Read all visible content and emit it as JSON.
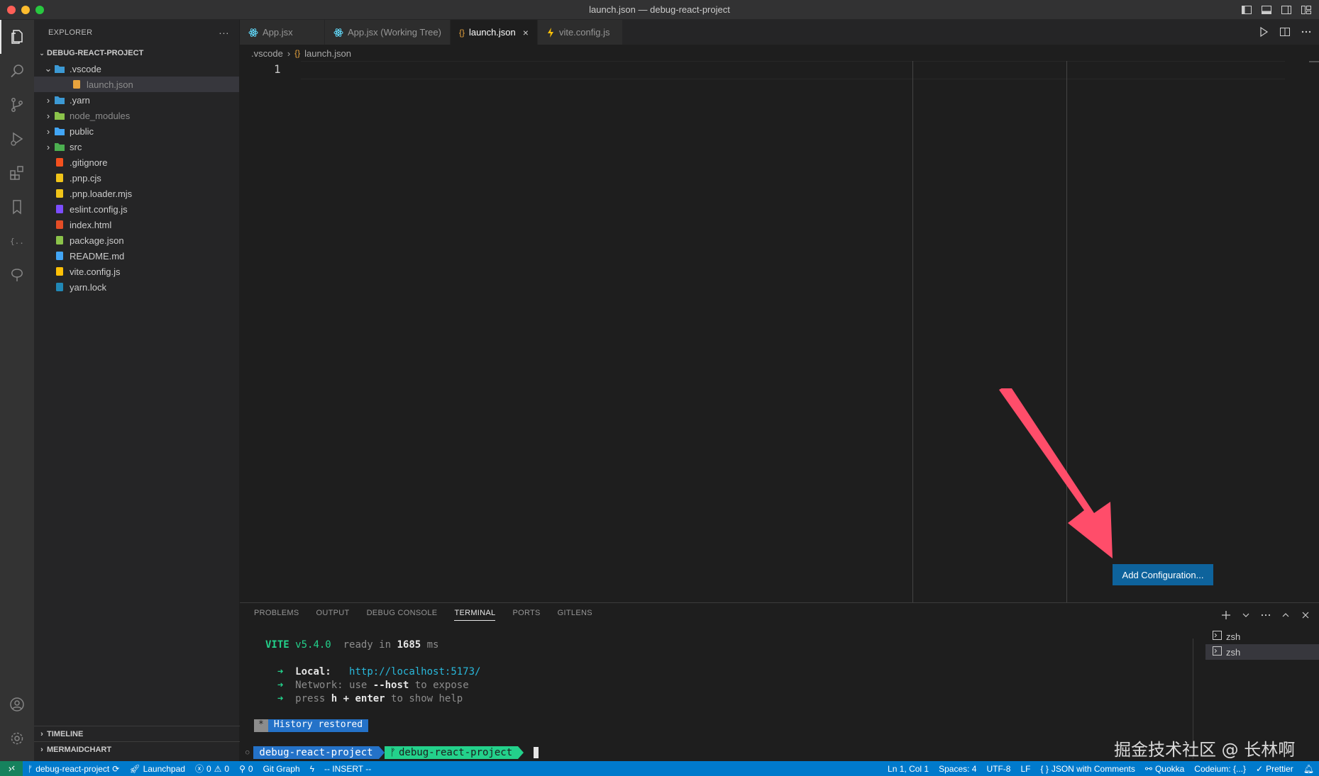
{
  "window": {
    "title": "launch.json — debug-react-project",
    "traffic_colors": [
      "#ff5f57",
      "#febc2e",
      "#28c840"
    ]
  },
  "activity": {
    "icons": [
      "files-icon",
      "search-icon",
      "source-control-icon",
      "run-debug-icon",
      "extensions-icon",
      "bookmark-icon",
      "json-icon",
      "tree-icon",
      "account-icon",
      "settings-gear-icon"
    ]
  },
  "explorer": {
    "title": "EXPLORER",
    "more": "···",
    "project": "DEBUG-REACT-PROJECT",
    "items": [
      {
        "label": ".vscode",
        "depth": 1,
        "expanded": true,
        "folder": true,
        "icon": "vscode-folder-icon",
        "color": "#3c99d4"
      },
      {
        "label": "launch.json",
        "depth": 2,
        "selected": true,
        "icon": "json-braces-icon",
        "color": "#e8a33d",
        "muted": true
      },
      {
        "label": ".yarn",
        "depth": 1,
        "folder": true,
        "icon": "yarn-folder-icon",
        "color": "#3c99d4"
      },
      {
        "label": "node_modules",
        "depth": 1,
        "folder": true,
        "icon": "node-folder-icon",
        "color": "#8bc34a",
        "muted": true
      },
      {
        "label": "public",
        "depth": 1,
        "folder": true,
        "icon": "public-folder-icon",
        "color": "#42a5f5"
      },
      {
        "label": "src",
        "depth": 1,
        "folder": true,
        "icon": "src-folder-icon",
        "color": "#4caf50"
      },
      {
        "label": ".gitignore",
        "depth": 1,
        "icon": "git-icon",
        "color": "#f4511e"
      },
      {
        "label": ".pnp.cjs",
        "depth": 1,
        "icon": "js-icon",
        "color": "#f0c419"
      },
      {
        "label": ".pnp.loader.mjs",
        "depth": 1,
        "icon": "js-icon",
        "color": "#f0c419"
      },
      {
        "label": "eslint.config.js",
        "depth": 1,
        "icon": "eslint-icon",
        "color": "#7c4dff"
      },
      {
        "label": "index.html",
        "depth": 1,
        "icon": "html-icon",
        "color": "#e44d26"
      },
      {
        "label": "package.json",
        "depth": 1,
        "icon": "nodejs-icon",
        "color": "#8bc34a"
      },
      {
        "label": "README.md",
        "depth": 1,
        "icon": "info-icon",
        "color": "#42a5f5"
      },
      {
        "label": "vite.config.js",
        "depth": 1,
        "icon": "vite-bolt-icon",
        "color": "#ffc107"
      },
      {
        "label": "yarn.lock",
        "depth": 1,
        "icon": "yarn-icon",
        "color": "#2188b6"
      }
    ],
    "timeline": "TIMELINE",
    "mermaid": "MERMAIDCHART"
  },
  "tabs": [
    {
      "label": "App.jsx",
      "icon": "react-icon",
      "color": "#61dafb"
    },
    {
      "label": "App.jsx (Working Tree)",
      "icon": "react-icon",
      "color": "#61dafb"
    },
    {
      "label": "launch.json",
      "icon": "json-braces-icon",
      "color": "#e8a33d",
      "active": true,
      "close": "×"
    },
    {
      "label": "vite.config.js",
      "icon": "vite-bolt-icon",
      "color": "#ffc107"
    }
  ],
  "breadcrumb": {
    "folder": ".vscode",
    "sep": "›",
    "file": "launch.json"
  },
  "editor": {
    "line": "1",
    "add_config": "Add Configuration..."
  },
  "panel": {
    "tabs": [
      "PROBLEMS",
      "OUTPUT",
      "DEBUG CONSOLE",
      "TERMINAL",
      "PORTS",
      "GITLENS"
    ],
    "active_tab": "TERMINAL",
    "terminal": {
      "vite": "VITE",
      "version": "v5.4.0",
      "ready": "ready in",
      "ms_value": "1685",
      "ms": "ms",
      "arrow": "➜",
      "local_label": "Local:",
      "local_url": "http://localhost:5173/",
      "network_label": "Network:",
      "network_use": "use",
      "network_host": "--host",
      "network_expose": "to expose",
      "press": "press",
      "h_enter": "h + enter",
      "show_help": "to show help",
      "history_star": "*",
      "history": "History restored",
      "prompt_dir": "debug-react-project",
      "prompt_branch": "debug-react-project"
    },
    "shells": [
      "zsh",
      "zsh"
    ]
  },
  "watermark": "掘金技术社区 @ 长林啊",
  "status": {
    "branch": "debug-react-project",
    "launchpad": "Launchpad",
    "errors": "0",
    "warnings": "0",
    "ports": "0",
    "git_graph": "Git Graph",
    "insert": "-- INSERT --",
    "position": "Ln 1, Col 1",
    "spaces": "Spaces: 4",
    "encoding": "UTF-8",
    "eol": "LF",
    "language": "JSON with Comments",
    "quokka": "Quokka",
    "codeium": "Codeium: {...}",
    "prettier": "Prettier"
  }
}
